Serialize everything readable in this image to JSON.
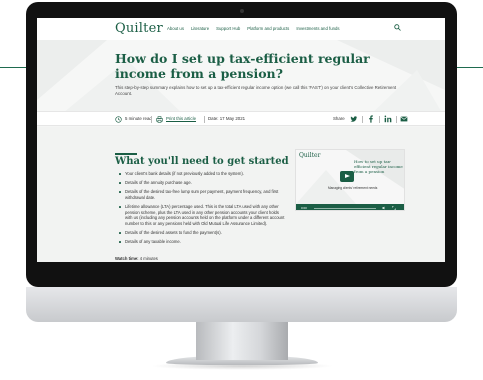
{
  "site": {
    "logo": "Quilter"
  },
  "nav": {
    "links": [
      "About us",
      "Literature",
      "Support Hub",
      "Platform and products",
      "Investments and funds"
    ],
    "search_icon": "search-icon"
  },
  "hero": {
    "title": "How do I set up tax-efficient regular income from a pension?",
    "subtitle": "This step-by-step summary explains how to set up a tax-efficient regular income option (we call this 'FAST') on your client's Collective Retirement Account."
  },
  "meta": {
    "read_time": "5 minute read",
    "print": "Print this article",
    "date": "Date: 17 May 2021",
    "share_label": "Share",
    "share_icons": [
      "twitter-icon",
      "facebook-icon",
      "linkedin-icon",
      "email-icon"
    ]
  },
  "section": {
    "heading": "What you'll need to get started",
    "bullets": [
      "Your client's bank details (if not previously added to the system).",
      "Details of the annuity purchase age.",
      "Details of the desired tax-free lump sum per payment, payment frequency, and first withdrawal date.",
      "Lifetime allowance (LTA) percentage used. This is the total LTA used with any other pension scheme, plus the LTA used in any other pension accounts your client holds with us (including any pension accounts held on the platform under a different account number to this or any pensions held with Old Mutual Life Assurance Limited).",
      "Details of the desired assets to fund the payment(s).",
      "Details of any taxable income."
    ],
    "watch_label": "Watch time:",
    "watch_value": "4 minutes"
  },
  "video": {
    "logo": "Quilter",
    "title": "How to set up tax-efficient regular income from a pension",
    "subtitle": "Managing clients' retirement needs",
    "time": "0:00",
    "progress": 0
  },
  "colors": {
    "brand": "#1b5e45",
    "background": "#f4f5f4"
  }
}
